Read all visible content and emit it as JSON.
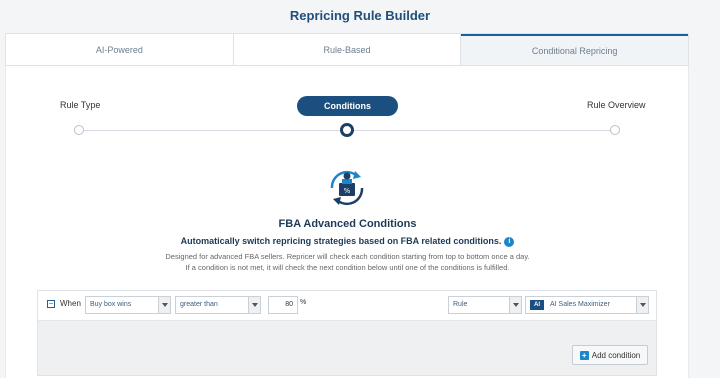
{
  "page": {
    "title": "Repricing Rule Builder"
  },
  "tabs": [
    {
      "label": "AI-Powered",
      "active": false
    },
    {
      "label": "Rule-Based",
      "active": false
    },
    {
      "label": "Conditional Repricing",
      "active": true
    }
  ],
  "steps": {
    "rule_type": "Rule Type",
    "conditions": "Conditions",
    "rule_overview": "Rule Overview"
  },
  "fba": {
    "title": "FBA Advanced Conditions",
    "subtitle": "Automatically switch repricing strategies based on FBA related conditions.",
    "desc_line1": "Designed for advanced FBA sellers. Repricer will check each condition starting from top to bottom once a day.",
    "desc_line2": "If a condition is not met, it will check the next condition below until one of the conditions is fulfilled."
  },
  "condition": {
    "collapse_symbol": "−",
    "when_label": "When",
    "metric": "Buy box wins",
    "operator": "greater than",
    "value": "80",
    "unit": "%",
    "action_type": "Rule",
    "strategy_badge": "AI",
    "strategy": "AI Sales Maximizer"
  },
  "add_condition": {
    "label": "Add condition",
    "icon": "+"
  },
  "colors": {
    "primary": "#1b4f80",
    "accent": "#1d86c8"
  }
}
